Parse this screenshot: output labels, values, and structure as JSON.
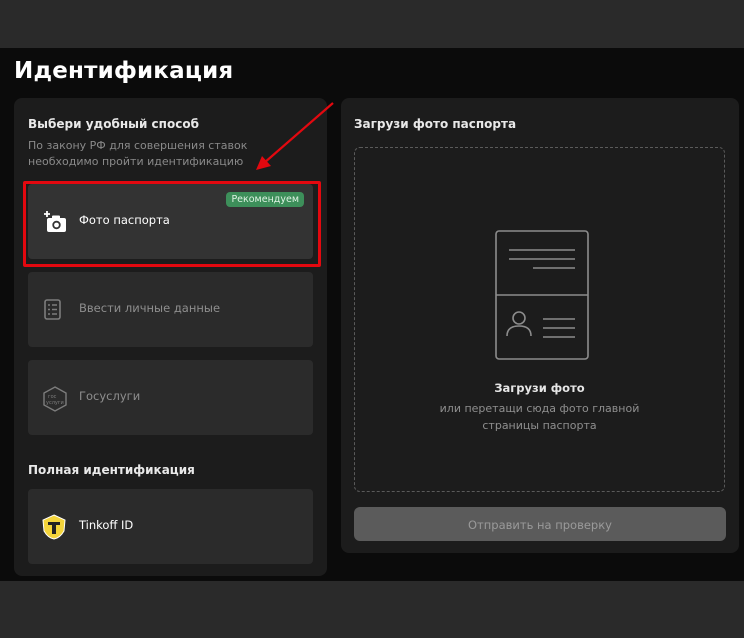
{
  "page": {
    "title": "Идентификация"
  },
  "left": {
    "choose_title": "Выбери удобный способ",
    "choose_sub_line1": "По закону РФ для совершения ставок",
    "choose_sub_line2": "необходимо пройти идентификацию",
    "methods": [
      {
        "label": "Фото паспорта",
        "badge": "Рекомендуем",
        "icon": "add-camera-icon"
      },
      {
        "label": "Ввести личные данные",
        "icon": "document-list-icon"
      },
      {
        "label": "Госуслуги",
        "icon": "gosuslugi-logo-icon",
        "logo_text": "гос\nуслуги"
      }
    ],
    "full_title": "Полная идентификация",
    "tinkoff": {
      "label": "Tinkoff ID",
      "icon": "tinkoff-shield-icon"
    }
  },
  "right": {
    "title": "Загрузи фото паспорта",
    "upload_title": "Загрузи фото",
    "upload_sub_line1": "или перетащи сюда фото главной",
    "upload_sub_line2": "страницы паспорта",
    "submit_label": "Отправить на проверку"
  },
  "colors": {
    "highlight": "#e3080f",
    "badge": "#3d8f5a",
    "panel": "#1c1c1c",
    "card": "#2b2b2b"
  }
}
